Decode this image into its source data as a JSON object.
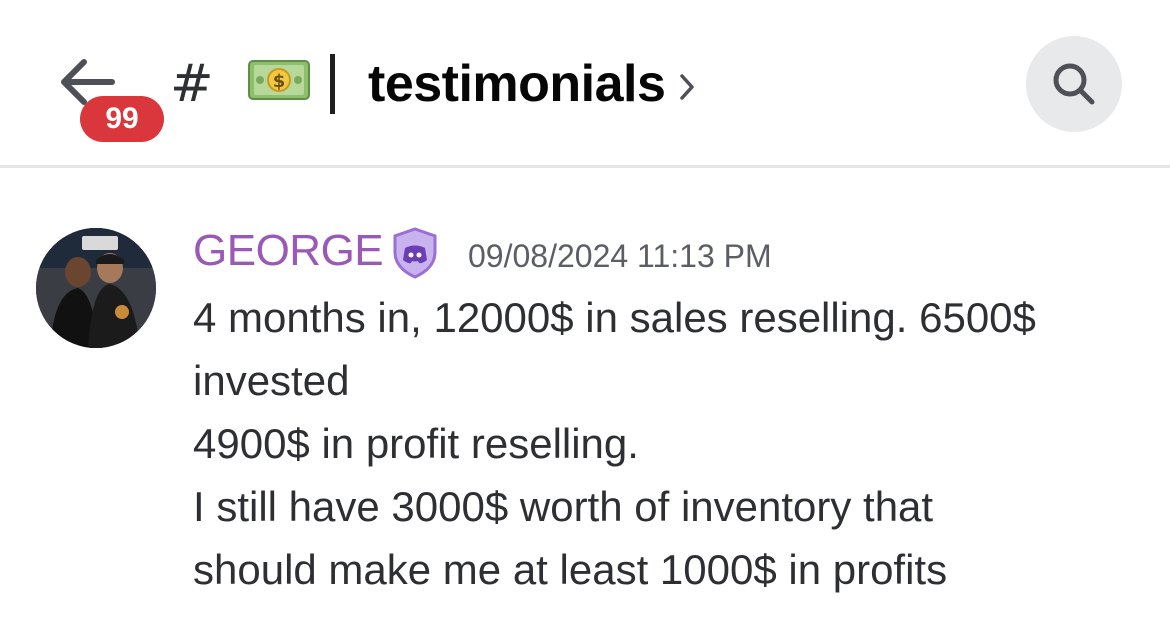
{
  "header": {
    "back_icon": "arrow-left-icon",
    "unread_count": "99",
    "hash_symbol": "#",
    "channel_emoji": "money-bill-icon",
    "separator": "|",
    "channel_name": "testimonials",
    "chevron_icon": "chevron-right-icon",
    "search_icon": "search-icon"
  },
  "message": {
    "author": "GEORGE",
    "author_color": "#9b59b6",
    "author_badge": "discord-shield-badge-icon",
    "timestamp": "09/08/2024 11:13 PM",
    "lines": [
      "4 months in, 12000$ in sales reselling. 6500$",
      "invested",
      "4900$ in profit reselling.",
      "I still have 3000$ worth of inventory that",
      "should make me at least 1000$ in profits"
    ]
  },
  "colors": {
    "badge_red": "#da373c",
    "divider": "#e3e5e8",
    "search_bg": "#e8e9eb"
  }
}
